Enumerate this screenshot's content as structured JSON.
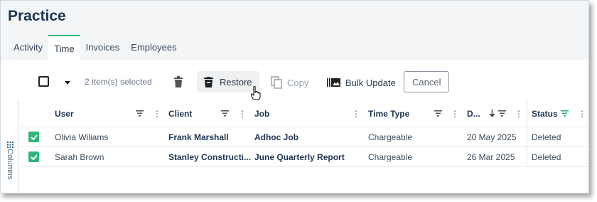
{
  "page": {
    "title": "Practice"
  },
  "tabs": [
    {
      "label": "Activity"
    },
    {
      "label": "Time"
    },
    {
      "label": "Invoices"
    },
    {
      "label": "Employees"
    }
  ],
  "active_tab": "Time",
  "toolbar": {
    "selected_count": "2 item(s) selected",
    "restore_label": "Restore",
    "copy_label": "Copy",
    "bulk_update_label": "Bulk Update",
    "cancel_label": "Cancel"
  },
  "side_panel": {
    "columns_label": "Columns"
  },
  "columns": [
    {
      "label": "User"
    },
    {
      "label": "Client"
    },
    {
      "label": "Job"
    },
    {
      "label": "Time Type"
    },
    {
      "label": "D..."
    },
    {
      "label": "Status"
    }
  ],
  "rows": [
    {
      "user": "Olivia Wiliams",
      "client": "Frank Marshall",
      "job": "Adhoc Job",
      "time_type": "Chargeable",
      "date": "20 May 2025",
      "status": "Deleted",
      "checked": true
    },
    {
      "user": "Sarah Brown",
      "client": "Stanley Constructi...",
      "job": "June Quarterly Report",
      "time_type": "Chargeable",
      "date": "26 Mar 2025",
      "status": "Deleted",
      "checked": true
    }
  ],
  "colors": {
    "accent": "#2fb57a",
    "heading": "#1f3550"
  },
  "icons": {
    "delete": "trash-icon",
    "restore": "restore-bin-icon",
    "copy": "copy-icon",
    "bulk": "bulk-update-icon",
    "filter": "filter-icon",
    "menu": "more-vertical-icon",
    "sort": "sort-descending-icon",
    "cursor": "hand-pointer-icon",
    "columns": "grid-icon"
  }
}
